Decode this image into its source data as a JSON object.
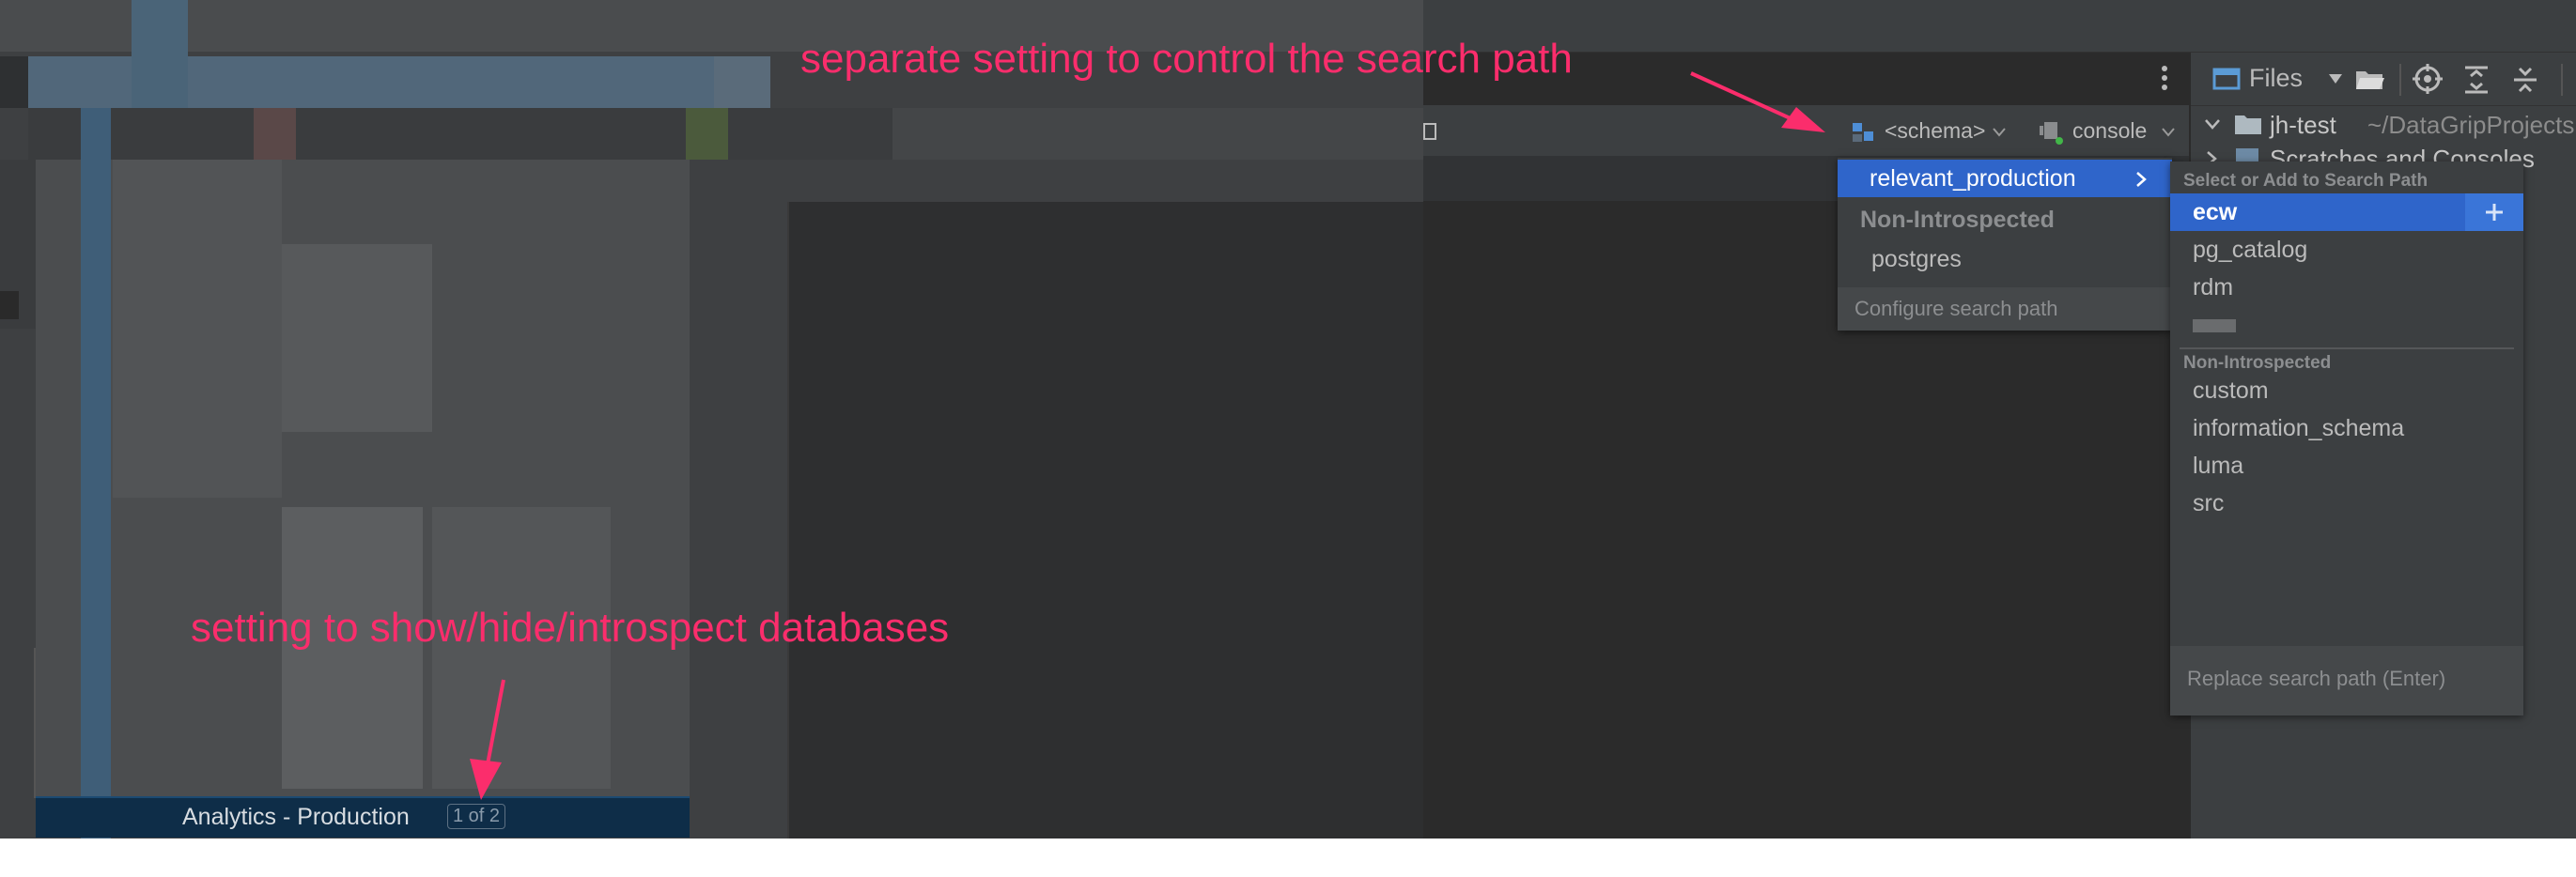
{
  "annotations": {
    "top": "separate setting to control the search path",
    "bottom": "setting to show/hide/introspect databases",
    "color": "#fb2d6c"
  },
  "toolbar": {
    "schema_selector": "<schema>",
    "console_selector": "console",
    "more_icon": "vertical-dots-icon"
  },
  "project_panel": {
    "view_mode": "Files",
    "root_name": "jh-test",
    "root_path": "~/DataGripProjects",
    "child": "Scratches and Consoles"
  },
  "status": {
    "data_source": "Analytics - Production",
    "counter": "1 of 2"
  },
  "db_menu": {
    "selected": "relevant_production",
    "section": "Non-Introspected",
    "items": [
      "postgres"
    ],
    "footer": "Configure search path"
  },
  "schema_menu": {
    "header": "Select or Add to Search Path",
    "selected": "ecw",
    "items": [
      "pg_catalog",
      "rdm"
    ],
    "section": "Non-Introspected",
    "non_introspected": [
      "custom",
      "information_schema",
      "luma",
      "src"
    ],
    "footer": "Replace search path (Enter)"
  },
  "colors": {
    "accent": "#2f65ca",
    "panel_bg": "#3c3f41",
    "editor_bg": "#2b2b2b"
  }
}
